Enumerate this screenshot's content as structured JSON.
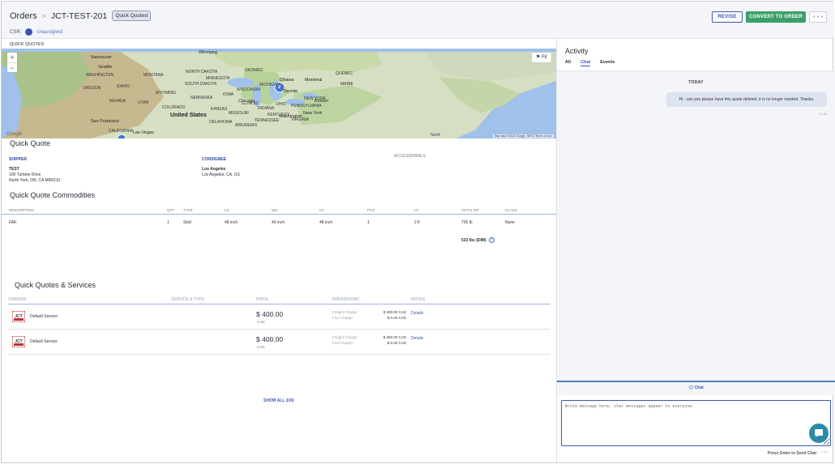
{
  "header": {
    "breadcrumb_root": "Orders",
    "breadcrumb_sep": ">",
    "order_id": "JCT-TEST-201",
    "status_badge": "Quick Quoted",
    "csr_label": "CSR:",
    "csr_value": "Unassigned",
    "revise_label": "REVISE",
    "convert_label": "CONVERT TO ORDER",
    "more_label": "• • •"
  },
  "map": {
    "section_label": "QUICK QUOTES",
    "zoom_in": "+",
    "zoom_out": "−",
    "fit_label": "Fit",
    "google": "Google",
    "north": "North",
    "attribution": "Map data ©2023 Google, INEGI   Terms of Use",
    "labels": {
      "winnipeg": "Winnipeg",
      "vancouver": "Vancouver",
      "seattle": "Seattle",
      "washington": "WASHINGTON",
      "oregon": "OREGON",
      "montana": "MONTANA",
      "idaho": "IDAHO",
      "north_dakota": "NORTH DAKOTA",
      "south_dakota": "SOUTH DAKOTA",
      "minnesota": "MINNESOTA",
      "wisconsin": "WISCONSIN",
      "michigan": "MICHIGAN",
      "wyoming": "WYOMING",
      "nebraska": "NEBRASKA",
      "nevada": "NEVADA",
      "utah": "UTAH",
      "colorado": "COLORADO",
      "kansas": "KANSAS",
      "iowa": "IOWA",
      "illinois": "ILLINOIS",
      "indiana": "INDIANA",
      "ohio": "OHIO",
      "missouri": "MISSOURI",
      "oklahoma": "OKLAHOMA",
      "arkansas": "ARKANSAS",
      "tennessee": "TENNESSEE",
      "kentucky": "KENTUCKY",
      "virginia": "VIRGINIA",
      "pennsylvania": "PENNSYLVANIA",
      "new_york_state": "NEW YORK",
      "maine": "MAINE",
      "quebec": "QUEBEC",
      "ontario": "ONTARIO",
      "california": "CALIFORNIA",
      "san_francisco": "San Francisco",
      "las_vegas": "Las Vegas",
      "united_states": "United States",
      "chicago": "Chicago",
      "toronto": "Toronto",
      "ottawa": "Ottawa",
      "montreal": "Montreal",
      "boston": "Boston",
      "new_york": "New York",
      "washington_dc": "Washington",
      "pin": "2"
    }
  },
  "quick_quote": {
    "title": "Quick Quote",
    "shipper_label": "SHIPPER",
    "shipper_name": "TEST",
    "shipper_addr1": "100 Turbine Drive",
    "shipper_addr2": "North York, ON, CA M9R2J3",
    "consignee_label": "CONSIGNEE",
    "consignee_name": "Los Angeles",
    "consignee_addr": "Los Angeles, CA, US",
    "accessorials_label": "ACCESSORIALS"
  },
  "commodities": {
    "title": "Quick Quote Commodities",
    "headers": [
      "DESCRIPTION",
      "QTY",
      "TYPE",
      "LG",
      "WD",
      "HT",
      "PCS",
      "LF",
      "TOTAL WT",
      "CLASS"
    ],
    "row": [
      "FAK",
      "1",
      "Skid",
      "48 inch",
      "40 inch",
      "48 inch",
      "1",
      "2 lf",
      "700 lb",
      "None"
    ],
    "dim_weight": "533 lbs (DIM)",
    "info_glyph": "?"
  },
  "services": {
    "title": "Quick Quotes & Services",
    "headers": [
      "CARRIER",
      "SERVICE & TYPE",
      "PRICE",
      "BREAKDOWN",
      "NOTES"
    ],
    "rows": [
      {
        "carrier_logo": "JCT",
        "service": "Default Service",
        "price": "$ 400.00",
        "currency": "CAD",
        "freight_label": "Freight Charge:",
        "freight_value": "$ 400.00 CAD",
        "fuel_label": "Fuel Charge:",
        "fuel_value": "$ 0.00 CAD",
        "link": "Details"
      },
      {
        "carrier_logo": "JCT",
        "service": "Default Service",
        "price": "$ 400.00",
        "currency": "CAD",
        "freight_label": "Freight Charge:",
        "freight_value": "$ 400.00 CAD",
        "fuel_label": "Fuel Charge:",
        "fuel_value": "$ 0.00 CAD",
        "link": "Details"
      }
    ],
    "show_all": "SHOW ALL 2/26"
  },
  "activity": {
    "title": "Activity",
    "tabs": [
      "All",
      "Chat",
      "Events"
    ],
    "active_tab": "Chat",
    "day_label": "TODAY",
    "message": "Hi - can you please have this quote deleted, it is no longer needed. Thanks.",
    "message_time": "11:58",
    "chat_tab": "Chat",
    "input_placeholder": "Write message here, chat messages appear to everyone.",
    "enter_hint": "Press Enter to Send Chat",
    "enter_more": "• • •"
  },
  "colors": {
    "accent": "#3b57b5",
    "convert": "#3aa06a",
    "chat_fab": "#2a8aa8"
  }
}
